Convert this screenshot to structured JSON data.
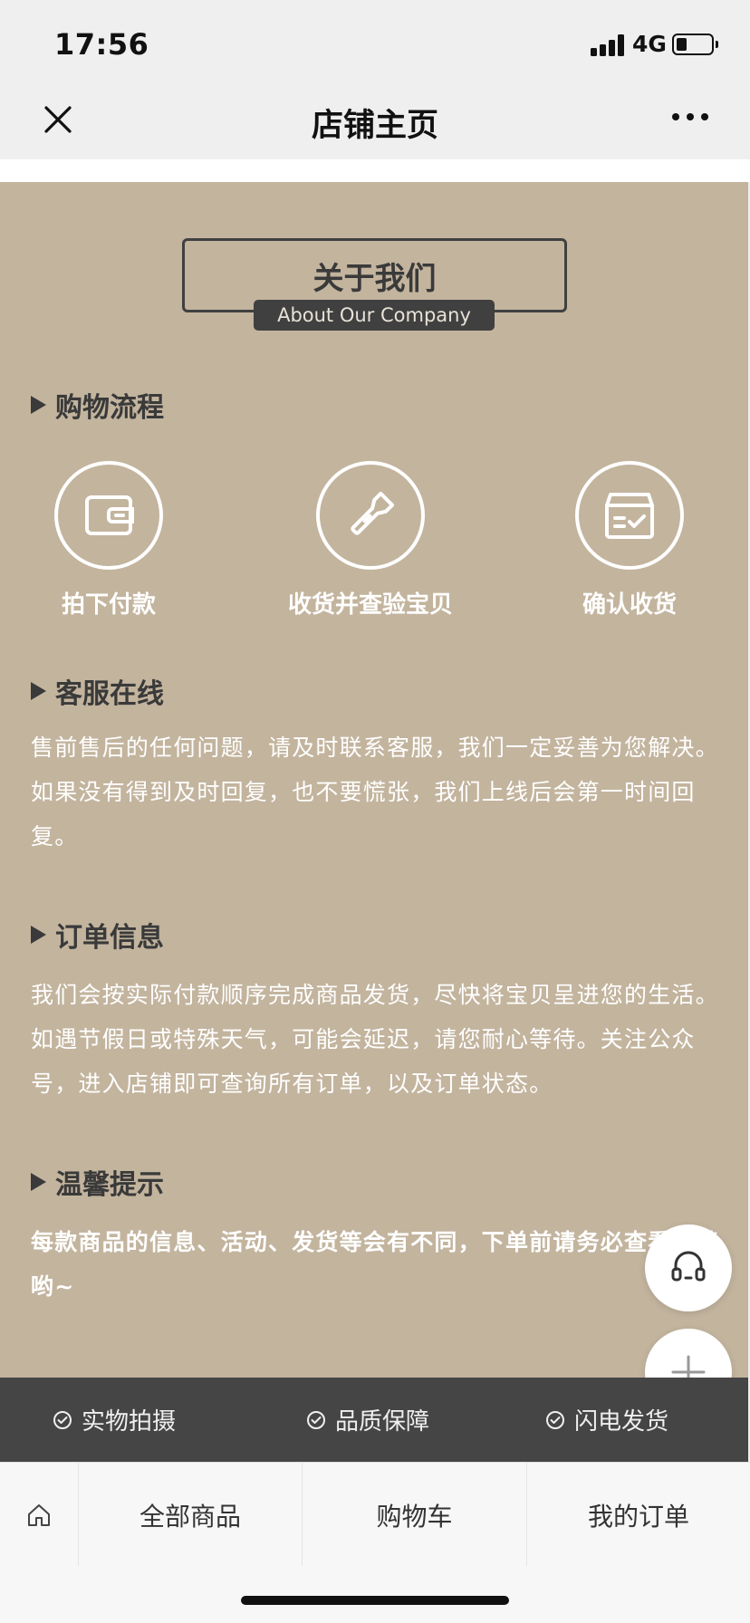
{
  "status_bar": {
    "time": "17:56",
    "network": "4G"
  },
  "nav": {
    "title": "店铺主页"
  },
  "about": {
    "title": "关于我们",
    "subtitle": "About Our Company"
  },
  "sections": {
    "shopping_flow": {
      "title": "购物流程"
    },
    "customer_service": {
      "title": "客服在线",
      "text": "售前售后的任何问题，请及时联系客服，我们一定妥善为您解决。如果没有得到及时回复，也不要慌张，我们上线后会第一时间回复。"
    },
    "order_info": {
      "title": "订单信息",
      "text": "我们会按实际付款顺序完成商品发货，尽快将宝贝呈进您的生活。如遇节假日或特殊天气，可能会延迟，请您耐心等待。关注公众号，进入店铺即可查询所有订单，以及订单状态。"
    },
    "tips": {
      "title": "温馨提示",
      "text": "每款商品的信息、活动、发货等会有不同，下单前请务必查看清楚哟~"
    }
  },
  "steps": [
    {
      "label": "拍下付款",
      "icon": "wallet-icon"
    },
    {
      "label": "收货并查验宝贝",
      "icon": "flashlight-icon"
    },
    {
      "label": "确认收货",
      "icon": "box-check-icon"
    }
  ],
  "guarantees": [
    {
      "label": "实物拍摄"
    },
    {
      "label": "品质保障"
    },
    {
      "label": "闪电发货"
    }
  ],
  "tabs": [
    {
      "label": "全部商品"
    },
    {
      "label": "购物车"
    },
    {
      "label": "我的订单"
    }
  ],
  "colors": {
    "content_bg": "#c3b49e",
    "dark_accent": "#404040",
    "guarantee_bg": "#454545",
    "tab_bg": "#f7f7f8"
  }
}
